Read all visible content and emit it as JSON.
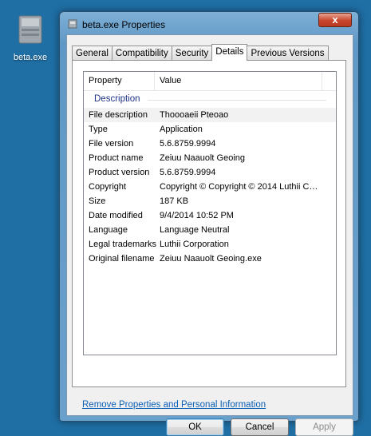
{
  "desktop": {
    "icon_label": "beta.exe",
    "icon": "file-icon"
  },
  "window": {
    "title": "beta.exe Properties",
    "close_label": "x",
    "tabs": [
      "General",
      "Compatibility",
      "Security",
      "Details",
      "Previous Versions"
    ],
    "active_tab": "Details"
  },
  "list": {
    "col_property": "Property",
    "col_value": "Value",
    "group": "Description",
    "rows": [
      {
        "k": "File description",
        "v": "Thoooaeii Pteoao"
      },
      {
        "k": "Type",
        "v": "Application"
      },
      {
        "k": "File version",
        "v": "5.6.8759.9994"
      },
      {
        "k": "Product name",
        "v": "Zeiuu Naauolt Geoing"
      },
      {
        "k": "Product version",
        "v": "5.6.8759.9994"
      },
      {
        "k": "Copyright",
        "v": "Copyright © Copyright © 2014 Luthii Co..."
      },
      {
        "k": "Size",
        "v": "187 KB"
      },
      {
        "k": "Date modified",
        "v": "9/4/2014 10:52 PM"
      },
      {
        "k": "Language",
        "v": "Language Neutral"
      },
      {
        "k": "Legal trademarks",
        "v": "Luthii Corporation"
      },
      {
        "k": "Original filename",
        "v": "Zeiuu Naauolt Geoing.exe"
      }
    ]
  },
  "remove_link": "Remove Properties and Personal Information",
  "buttons": {
    "ok": "OK",
    "cancel": "Cancel",
    "apply": "Apply"
  }
}
